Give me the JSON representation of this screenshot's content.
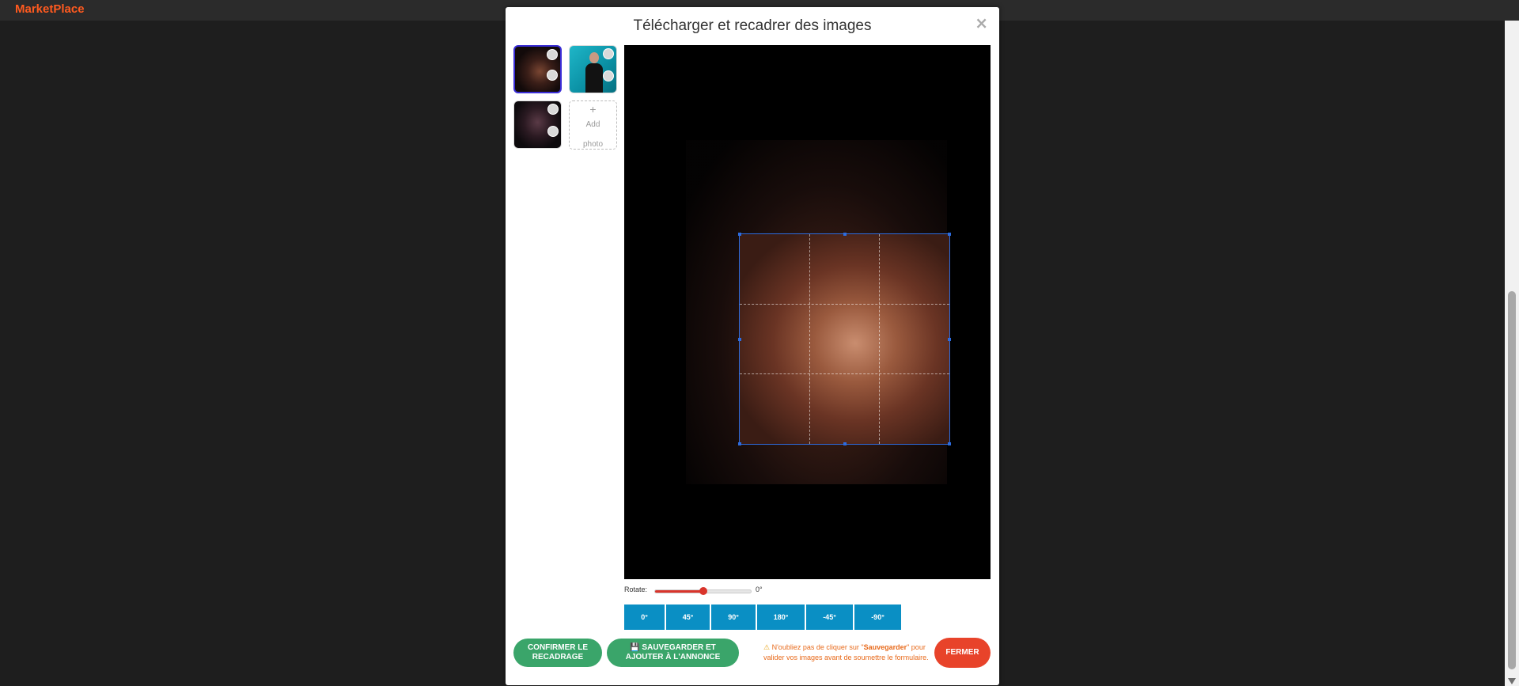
{
  "app": {
    "brand": "MarketPlace"
  },
  "modal": {
    "title": "Télécharger et recadrer des images",
    "close_symbol": "×",
    "thumbnails": [
      {
        "name": "photo-1",
        "active": true
      },
      {
        "name": "photo-2",
        "active": false
      },
      {
        "name": "photo-3",
        "active": false
      }
    ],
    "add_photo": {
      "plus": "+",
      "line1": "Add",
      "line2": "photo"
    },
    "rotate": {
      "label": "Rotate:",
      "value": "0°",
      "slider_fraction": 0.5,
      "buttons": [
        "0°",
        "45°",
        "90°",
        "180°",
        "-45°",
        "-90°"
      ]
    },
    "actions": {
      "confirm_line1": "CONFIRMER LE",
      "confirm_line2": "RECADRAGE",
      "save_line1": "SAUVEGARDER ET",
      "save_line2": "AJOUTER À L'ANNONCE",
      "close": "FERMER"
    },
    "warning": {
      "icon": "⚠",
      "prefix": "N'oubliez pas de cliquer sur \"",
      "bold": "Sauvegarder",
      "suffix": "\" pour valider vos images avant de soumettre le formulaire."
    }
  },
  "colors": {
    "brand": "#ff5a1f",
    "accent_blue": "#0a8fc4",
    "green": "#3aa56a",
    "red": "#e8432a",
    "slider": "#d9342b",
    "warning_text": "#e86a1b"
  }
}
